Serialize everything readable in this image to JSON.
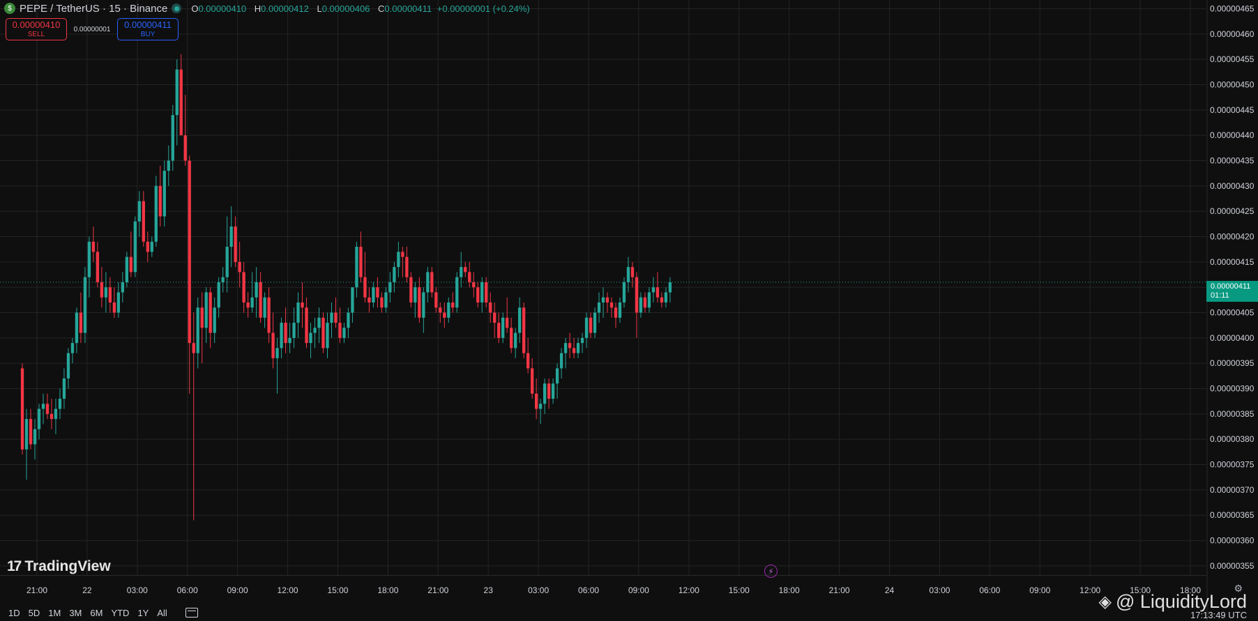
{
  "legend": {
    "symbol": "PEPE / TetherUS · 15 · Binance",
    "coin_glyph": "$",
    "open_label": "O",
    "open": "0.00000410",
    "high_label": "H",
    "high": "0.00000412",
    "low_label": "L",
    "low": "0.00000406",
    "close_label": "C",
    "close": "0.00000411",
    "change": "+0.00000001 (+0.24%)"
  },
  "trade": {
    "sell_price": "0.00000410",
    "sell_label": "SELL",
    "spread": "0.00000001",
    "buy_price": "0.00000411",
    "buy_label": "BUY"
  },
  "current_price": {
    "price": "0.00000411",
    "countdown": "01:11"
  },
  "brand": {
    "logo_mark": "17",
    "name": "TradingView"
  },
  "bolt_glyph": "⚡",
  "ranges": [
    "1D",
    "5D",
    "1M",
    "3M",
    "6M",
    "YTD",
    "1Y",
    "All"
  ],
  "watermark": {
    "glyph": "◈",
    "text": "@ LiquidityLord"
  },
  "clock": "17:13:49 UTC",
  "gear_glyph": "⚙",
  "colors": {
    "up": "#26a69a",
    "down": "#f23645",
    "bg": "#0f0f0f",
    "grid": "#242424"
  },
  "chart_data": {
    "type": "candlestick",
    "interval_minutes": 15,
    "y_ticks": [
      "0.00000355",
      "0.00000360",
      "0.00000365",
      "0.00000370",
      "0.00000375",
      "0.00000380",
      "0.00000385",
      "0.00000390",
      "0.00000395",
      "0.00000400",
      "0.00000405",
      "0.00000410",
      "0.00000415",
      "0.00000420",
      "0.00000425",
      "0.00000430",
      "0.00000435",
      "0.00000440",
      "0.00000445",
      "0.00000450",
      "0.00000455",
      "0.00000460",
      "0.00000465"
    ],
    "ylim": [
      3.55,
      4.66
    ],
    "y_unit": "1e-6 USDT",
    "x_ticks": [
      "21:00",
      "22",
      "03:00",
      "06:00",
      "09:00",
      "12:00",
      "15:00",
      "18:00",
      "21:00",
      "23",
      "03:00",
      "06:00",
      "09:00",
      "12:00",
      "15:00",
      "18:00",
      "21:00",
      "24",
      "03:00",
      "06:00",
      "09:00",
      "12:00",
      "15:00",
      "18:00"
    ],
    "x_tick_hours": [
      21,
      24,
      27,
      30,
      33,
      36,
      39,
      42,
      45,
      48,
      51,
      54,
      57,
      60,
      63,
      66,
      69,
      72,
      75,
      78,
      81,
      84,
      87,
      90
    ],
    "xlim_hours": [
      20.125,
      93.0
    ],
    "candles_start_hour": 20.125,
    "candles": [
      [
        3.94,
        3.95,
        3.77,
        3.78
      ],
      [
        3.78,
        3.86,
        3.72,
        3.84
      ],
      [
        3.84,
        3.86,
        3.78,
        3.79
      ],
      [
        3.79,
        3.84,
        3.76,
        3.82
      ],
      [
        3.82,
        3.87,
        3.8,
        3.86
      ],
      [
        3.86,
        3.89,
        3.83,
        3.87
      ],
      [
        3.87,
        3.89,
        3.84,
        3.85
      ],
      [
        3.85,
        3.88,
        3.82,
        3.84
      ],
      [
        3.84,
        3.88,
        3.81,
        3.86
      ],
      [
        3.86,
        3.9,
        3.84,
        3.88
      ],
      [
        3.88,
        3.94,
        3.86,
        3.92
      ],
      [
        3.92,
        3.98,
        3.9,
        3.97
      ],
      [
        3.97,
        4.0,
        3.95,
        3.99
      ],
      [
        3.99,
        4.06,
        3.97,
        4.05
      ],
      [
        4.05,
        4.09,
        3.99,
        4.01
      ],
      [
        4.01,
        4.14,
        3.99,
        4.12
      ],
      [
        4.12,
        4.2,
        4.08,
        4.19
      ],
      [
        4.19,
        4.22,
        4.15,
        4.17
      ],
      [
        4.17,
        4.19,
        4.1,
        4.11
      ],
      [
        4.11,
        4.14,
        4.06,
        4.08
      ],
      [
        4.08,
        4.13,
        4.05,
        4.1
      ],
      [
        4.1,
        4.12,
        4.05,
        4.07
      ],
      [
        4.07,
        4.1,
        4.04,
        4.05
      ],
      [
        4.05,
        4.11,
        4.04,
        4.09
      ],
      [
        4.09,
        4.13,
        4.07,
        4.11
      ],
      [
        4.11,
        4.17,
        4.1,
        4.16
      ],
      [
        4.16,
        4.21,
        4.12,
        4.13
      ],
      [
        4.13,
        4.24,
        4.12,
        4.23
      ],
      [
        4.23,
        4.29,
        4.2,
        4.27
      ],
      [
        4.27,
        4.29,
        4.18,
        4.19
      ],
      [
        4.19,
        4.21,
        4.15,
        4.17
      ],
      [
        4.17,
        4.2,
        4.16,
        4.19
      ],
      [
        4.19,
        4.32,
        4.18,
        4.3
      ],
      [
        4.3,
        4.34,
        4.22,
        4.24
      ],
      [
        4.24,
        4.35,
        4.22,
        4.33
      ],
      [
        4.33,
        4.38,
        4.3,
        4.35
      ],
      [
        4.35,
        4.46,
        4.33,
        4.44
      ],
      [
        4.44,
        4.55,
        4.38,
        4.53
      ],
      [
        4.53,
        4.56,
        4.4,
        4.4
      ],
      [
        4.4,
        4.48,
        4.34,
        4.35
      ],
      [
        4.35,
        4.36,
        3.89,
        3.99
      ],
      [
        3.99,
        4.05,
        3.64,
        3.97
      ],
      [
        3.97,
        4.08,
        3.94,
        4.06
      ],
      [
        4.06,
        4.09,
        3.95,
        4.02
      ],
      [
        4.02,
        4.1,
        3.99,
        4.09
      ],
      [
        4.09,
        4.1,
        3.98,
        4.01
      ],
      [
        4.01,
        4.08,
        3.99,
        4.06
      ],
      [
        4.06,
        4.12,
        4.04,
        4.11
      ],
      [
        4.11,
        4.14,
        4.09,
        4.12
      ],
      [
        4.12,
        4.24,
        4.09,
        4.18
      ],
      [
        4.18,
        4.26,
        4.14,
        4.22
      ],
      [
        4.22,
        4.24,
        4.14,
        4.15
      ],
      [
        4.15,
        4.19,
        4.1,
        4.13
      ],
      [
        4.13,
        4.15,
        4.05,
        4.07
      ],
      [
        4.07,
        4.09,
        4.04,
        4.06
      ],
      [
        4.06,
        4.13,
        4.05,
        4.08
      ],
      [
        4.08,
        4.14,
        4.04,
        4.11
      ],
      [
        4.11,
        4.13,
        4.03,
        4.04
      ],
      [
        4.04,
        4.09,
        4.02,
        4.08
      ],
      [
        4.08,
        4.1,
        3.99,
        4.01
      ],
      [
        4.01,
        4.05,
        3.94,
        3.96
      ],
      [
        3.96,
        4.0,
        3.89,
        3.98
      ],
      [
        3.98,
        4.04,
        3.96,
        4.03
      ],
      [
        4.03,
        4.06,
        3.97,
        3.99
      ],
      [
        3.99,
        4.03,
        3.97,
        4.0
      ],
      [
        4.0,
        4.06,
        3.98,
        4.03
      ],
      [
        4.03,
        4.09,
        4.0,
        4.07
      ],
      [
        4.07,
        4.11,
        4.02,
        4.06
      ],
      [
        4.06,
        4.08,
        3.98,
        3.99
      ],
      [
        3.99,
        4.03,
        3.96,
        4.01
      ],
      [
        4.01,
        4.04,
        3.98,
        4.02
      ],
      [
        4.02,
        4.06,
        3.99,
        4.04
      ],
      [
        4.04,
        4.05,
        3.97,
        3.98
      ],
      [
        3.98,
        4.05,
        3.96,
        4.03
      ],
      [
        4.03,
        4.07,
        4.0,
        4.05
      ],
      [
        4.05,
        4.08,
        4.02,
        4.03
      ],
      [
        4.03,
        4.06,
        3.99,
        4.0
      ],
      [
        4.0,
        4.03,
        3.99,
        4.02
      ],
      [
        4.02,
        4.06,
        4.0,
        4.05
      ],
      [
        4.05,
        4.1,
        4.03,
        4.1
      ],
      [
        4.1,
        4.19,
        4.08,
        4.18
      ],
      [
        4.18,
        4.21,
        4.11,
        4.12
      ],
      [
        4.12,
        4.17,
        4.07,
        4.08
      ],
      [
        4.08,
        4.1,
        4.05,
        4.07
      ],
      [
        4.07,
        4.11,
        4.06,
        4.1
      ],
      [
        4.1,
        4.12,
        4.06,
        4.08
      ],
      [
        4.08,
        4.09,
        4.05,
        4.06
      ],
      [
        4.06,
        4.1,
        4.05,
        4.09
      ],
      [
        4.09,
        4.13,
        4.07,
        4.11
      ],
      [
        4.11,
        4.15,
        4.09,
        4.14
      ],
      [
        4.14,
        4.19,
        4.12,
        4.17
      ],
      [
        4.17,
        4.18,
        4.12,
        4.16
      ],
      [
        4.16,
        4.18,
        4.11,
        4.12
      ],
      [
        4.12,
        4.13,
        4.06,
        4.07
      ],
      [
        4.07,
        4.11,
        4.04,
        4.1
      ],
      [
        4.1,
        4.12,
        4.03,
        4.04
      ],
      [
        4.04,
        4.1,
        4.01,
        4.09
      ],
      [
        4.09,
        4.14,
        4.07,
        4.13
      ],
      [
        4.13,
        4.14,
        4.08,
        4.09
      ],
      [
        4.09,
        4.1,
        4.05,
        4.06
      ],
      [
        4.06,
        4.07,
        4.03,
        4.05
      ],
      [
        4.05,
        4.07,
        4.02,
        4.04
      ],
      [
        4.04,
        4.08,
        4.03,
        4.07
      ],
      [
        4.07,
        4.09,
        4.05,
        4.06
      ],
      [
        4.06,
        4.13,
        4.05,
        4.12
      ],
      [
        4.12,
        4.17,
        4.1,
        4.14
      ],
      [
        4.14,
        4.15,
        4.12,
        4.13
      ],
      [
        4.13,
        4.15,
        4.1,
        4.11
      ],
      [
        4.11,
        4.13,
        4.08,
        4.1
      ],
      [
        4.1,
        4.11,
        4.06,
        4.07
      ],
      [
        4.07,
        4.12,
        4.05,
        4.11
      ],
      [
        4.11,
        4.12,
        4.06,
        4.07
      ],
      [
        4.07,
        4.09,
        4.03,
        4.05
      ],
      [
        4.05,
        4.07,
        4.0,
        4.03
      ],
      [
        4.03,
        4.05,
        3.99,
        4.0
      ],
      [
        4.0,
        4.05,
        3.99,
        4.04
      ],
      [
        4.04,
        4.08,
        4.01,
        4.02
      ],
      [
        4.02,
        4.04,
        3.97,
        3.98
      ],
      [
        3.98,
        4.02,
        3.96,
        4.01
      ],
      [
        4.01,
        4.08,
        3.99,
        4.06
      ],
      [
        4.06,
        4.07,
        3.96,
        3.97
      ],
      [
        3.97,
        4.0,
        3.93,
        3.94
      ],
      [
        3.94,
        3.96,
        3.88,
        3.89
      ],
      [
        3.89,
        3.92,
        3.84,
        3.86
      ],
      [
        3.86,
        3.88,
        3.83,
        3.87
      ],
      [
        3.87,
        3.92,
        3.85,
        3.91
      ],
      [
        3.91,
        3.92,
        3.86,
        3.88
      ],
      [
        3.88,
        3.92,
        3.87,
        3.91
      ],
      [
        3.91,
        3.95,
        3.88,
        3.94
      ],
      [
        3.94,
        3.98,
        3.92,
        3.97
      ],
      [
        3.97,
        4.0,
        3.94,
        3.99
      ],
      [
        3.99,
        4.01,
        3.96,
        3.98
      ],
      [
        3.98,
        4.0,
        3.96,
        3.97
      ],
      [
        3.97,
        4.0,
        3.96,
        3.99
      ],
      [
        3.99,
        4.01,
        3.97,
        4.0
      ],
      [
        4.0,
        4.05,
        3.98,
        4.04
      ],
      [
        4.04,
        4.05,
        4.0,
        4.01
      ],
      [
        4.01,
        4.06,
        4.0,
        4.05
      ],
      [
        4.05,
        4.09,
        4.03,
        4.07
      ],
      [
        4.07,
        4.1,
        4.04,
        4.08
      ],
      [
        4.08,
        4.09,
        4.05,
        4.07
      ],
      [
        4.07,
        4.08,
        4.04,
        4.06
      ],
      [
        4.06,
        4.07,
        4.02,
        4.04
      ],
      [
        4.04,
        4.08,
        4.03,
        4.07
      ],
      [
        4.07,
        4.12,
        4.06,
        4.11
      ],
      [
        4.11,
        4.16,
        4.09,
        4.14
      ],
      [
        4.14,
        4.15,
        4.1,
        4.12
      ],
      [
        4.12,
        4.13,
        4.0,
        4.05
      ],
      [
        4.05,
        4.09,
        4.04,
        4.08
      ],
      [
        4.08,
        4.09,
        4.05,
        4.06
      ],
      [
        4.06,
        4.1,
        4.05,
        4.09
      ],
      [
        4.09,
        4.12,
        4.07,
        4.1
      ],
      [
        4.1,
        4.13,
        4.07,
        4.08
      ],
      [
        4.08,
        4.09,
        4.06,
        4.07
      ],
      [
        4.07,
        4.1,
        4.06,
        4.09
      ],
      [
        4.09,
        4.12,
        4.07,
        4.11
      ]
    ]
  }
}
